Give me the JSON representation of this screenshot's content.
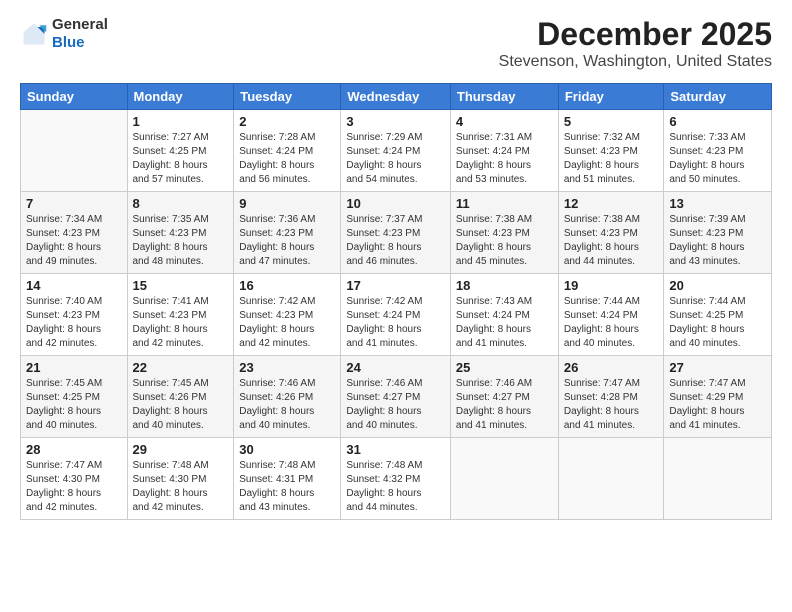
{
  "header": {
    "logo_general": "General",
    "logo_blue": "Blue",
    "month_title": "December 2025",
    "location": "Stevenson, Washington, United States"
  },
  "days_of_week": [
    "Sunday",
    "Monday",
    "Tuesday",
    "Wednesday",
    "Thursday",
    "Friday",
    "Saturday"
  ],
  "weeks": [
    [
      {
        "day": "",
        "info": ""
      },
      {
        "day": "1",
        "info": "Sunrise: 7:27 AM\nSunset: 4:25 PM\nDaylight: 8 hours\nand 57 minutes."
      },
      {
        "day": "2",
        "info": "Sunrise: 7:28 AM\nSunset: 4:24 PM\nDaylight: 8 hours\nand 56 minutes."
      },
      {
        "day": "3",
        "info": "Sunrise: 7:29 AM\nSunset: 4:24 PM\nDaylight: 8 hours\nand 54 minutes."
      },
      {
        "day": "4",
        "info": "Sunrise: 7:31 AM\nSunset: 4:24 PM\nDaylight: 8 hours\nand 53 minutes."
      },
      {
        "day": "5",
        "info": "Sunrise: 7:32 AM\nSunset: 4:23 PM\nDaylight: 8 hours\nand 51 minutes."
      },
      {
        "day": "6",
        "info": "Sunrise: 7:33 AM\nSunset: 4:23 PM\nDaylight: 8 hours\nand 50 minutes."
      }
    ],
    [
      {
        "day": "7",
        "info": "Sunrise: 7:34 AM\nSunset: 4:23 PM\nDaylight: 8 hours\nand 49 minutes."
      },
      {
        "day": "8",
        "info": "Sunrise: 7:35 AM\nSunset: 4:23 PM\nDaylight: 8 hours\nand 48 minutes."
      },
      {
        "day": "9",
        "info": "Sunrise: 7:36 AM\nSunset: 4:23 PM\nDaylight: 8 hours\nand 47 minutes."
      },
      {
        "day": "10",
        "info": "Sunrise: 7:37 AM\nSunset: 4:23 PM\nDaylight: 8 hours\nand 46 minutes."
      },
      {
        "day": "11",
        "info": "Sunrise: 7:38 AM\nSunset: 4:23 PM\nDaylight: 8 hours\nand 45 minutes."
      },
      {
        "day": "12",
        "info": "Sunrise: 7:38 AM\nSunset: 4:23 PM\nDaylight: 8 hours\nand 44 minutes."
      },
      {
        "day": "13",
        "info": "Sunrise: 7:39 AM\nSunset: 4:23 PM\nDaylight: 8 hours\nand 43 minutes."
      }
    ],
    [
      {
        "day": "14",
        "info": "Sunrise: 7:40 AM\nSunset: 4:23 PM\nDaylight: 8 hours\nand 42 minutes."
      },
      {
        "day": "15",
        "info": "Sunrise: 7:41 AM\nSunset: 4:23 PM\nDaylight: 8 hours\nand 42 minutes."
      },
      {
        "day": "16",
        "info": "Sunrise: 7:42 AM\nSunset: 4:23 PM\nDaylight: 8 hours\nand 42 minutes."
      },
      {
        "day": "17",
        "info": "Sunrise: 7:42 AM\nSunset: 4:24 PM\nDaylight: 8 hours\nand 41 minutes."
      },
      {
        "day": "18",
        "info": "Sunrise: 7:43 AM\nSunset: 4:24 PM\nDaylight: 8 hours\nand 41 minutes."
      },
      {
        "day": "19",
        "info": "Sunrise: 7:44 AM\nSunset: 4:24 PM\nDaylight: 8 hours\nand 40 minutes."
      },
      {
        "day": "20",
        "info": "Sunrise: 7:44 AM\nSunset: 4:25 PM\nDaylight: 8 hours\nand 40 minutes."
      }
    ],
    [
      {
        "day": "21",
        "info": "Sunrise: 7:45 AM\nSunset: 4:25 PM\nDaylight: 8 hours\nand 40 minutes."
      },
      {
        "day": "22",
        "info": "Sunrise: 7:45 AM\nSunset: 4:26 PM\nDaylight: 8 hours\nand 40 minutes."
      },
      {
        "day": "23",
        "info": "Sunrise: 7:46 AM\nSunset: 4:26 PM\nDaylight: 8 hours\nand 40 minutes."
      },
      {
        "day": "24",
        "info": "Sunrise: 7:46 AM\nSunset: 4:27 PM\nDaylight: 8 hours\nand 40 minutes."
      },
      {
        "day": "25",
        "info": "Sunrise: 7:46 AM\nSunset: 4:27 PM\nDaylight: 8 hours\nand 41 minutes."
      },
      {
        "day": "26",
        "info": "Sunrise: 7:47 AM\nSunset: 4:28 PM\nDaylight: 8 hours\nand 41 minutes."
      },
      {
        "day": "27",
        "info": "Sunrise: 7:47 AM\nSunset: 4:29 PM\nDaylight: 8 hours\nand 41 minutes."
      }
    ],
    [
      {
        "day": "28",
        "info": "Sunrise: 7:47 AM\nSunset: 4:30 PM\nDaylight: 8 hours\nand 42 minutes."
      },
      {
        "day": "29",
        "info": "Sunrise: 7:48 AM\nSunset: 4:30 PM\nDaylight: 8 hours\nand 42 minutes."
      },
      {
        "day": "30",
        "info": "Sunrise: 7:48 AM\nSunset: 4:31 PM\nDaylight: 8 hours\nand 43 minutes."
      },
      {
        "day": "31",
        "info": "Sunrise: 7:48 AM\nSunset: 4:32 PM\nDaylight: 8 hours\nand 44 minutes."
      },
      {
        "day": "",
        "info": ""
      },
      {
        "day": "",
        "info": ""
      },
      {
        "day": "",
        "info": ""
      }
    ]
  ]
}
